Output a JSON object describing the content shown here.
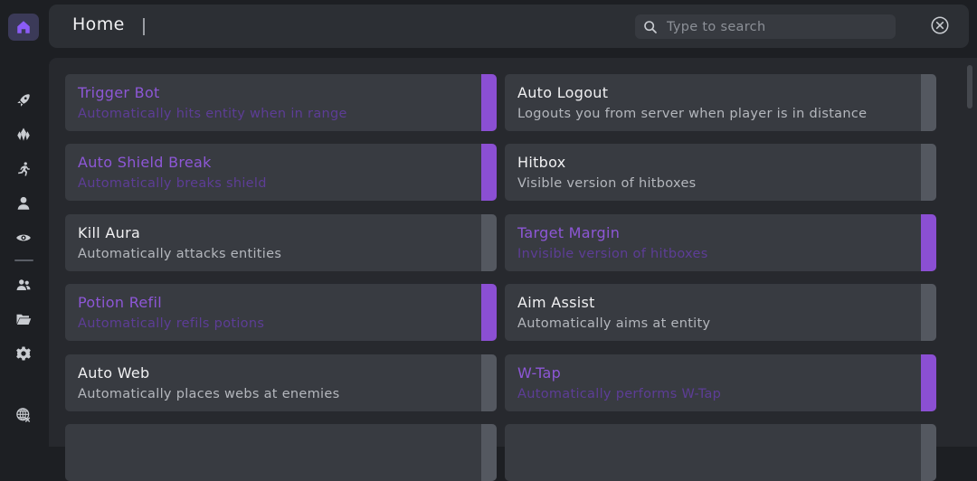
{
  "header": {
    "title": "Home",
    "search_placeholder": "Type to search"
  },
  "colors": {
    "accent": "#8b4fd3",
    "accent_text": "#8d57d6",
    "card_bg": "#383b41",
    "panel_bg": "#27292e",
    "app_bg": "#1d1f23"
  },
  "sidebar": {
    "items": [
      {
        "icon": "home-icon",
        "active": true
      },
      {
        "icon": "rocket-icon",
        "active": false
      },
      {
        "icon": "crystal-icon",
        "active": false
      },
      {
        "icon": "running-person-icon",
        "active": false
      },
      {
        "icon": "user-icon",
        "active": false
      },
      {
        "icon": "eye-icon",
        "active": false
      },
      {
        "icon": "users-icon",
        "active": false
      },
      {
        "icon": "folder-icon",
        "active": false
      },
      {
        "icon": "gear-icon",
        "active": false
      },
      {
        "icon": "globe-grid-icon",
        "active": false
      }
    ]
  },
  "modules": [
    {
      "name": "Trigger Bot",
      "desc": "Automatically hits entity when in range",
      "enabled": true
    },
    {
      "name": "Auto Logout",
      "desc": "Logouts you from server when player is in distance",
      "enabled": false
    },
    {
      "name": "Auto Shield Break",
      "desc": "Automatically breaks shield",
      "enabled": true
    },
    {
      "name": "Hitbox",
      "desc": "Visible version of hitboxes",
      "enabled": false
    },
    {
      "name": "Kill Aura",
      "desc": "Automatically attacks entities",
      "enabled": false
    },
    {
      "name": "Target Margin",
      "desc": "Invisible version of hitboxes",
      "enabled": true
    },
    {
      "name": "Potion Refil",
      "desc": "Automatically refils potions",
      "enabled": true
    },
    {
      "name": "Aim Assist",
      "desc": "Automatically aims at entity",
      "enabled": false
    },
    {
      "name": "Auto Web",
      "desc": "Automatically places webs at enemies",
      "enabled": false
    },
    {
      "name": "W-Tap",
      "desc": "Automatically performs W-Tap",
      "enabled": true
    },
    {
      "name": "",
      "desc": "",
      "enabled": false
    },
    {
      "name": "",
      "desc": "",
      "enabled": false
    }
  ]
}
